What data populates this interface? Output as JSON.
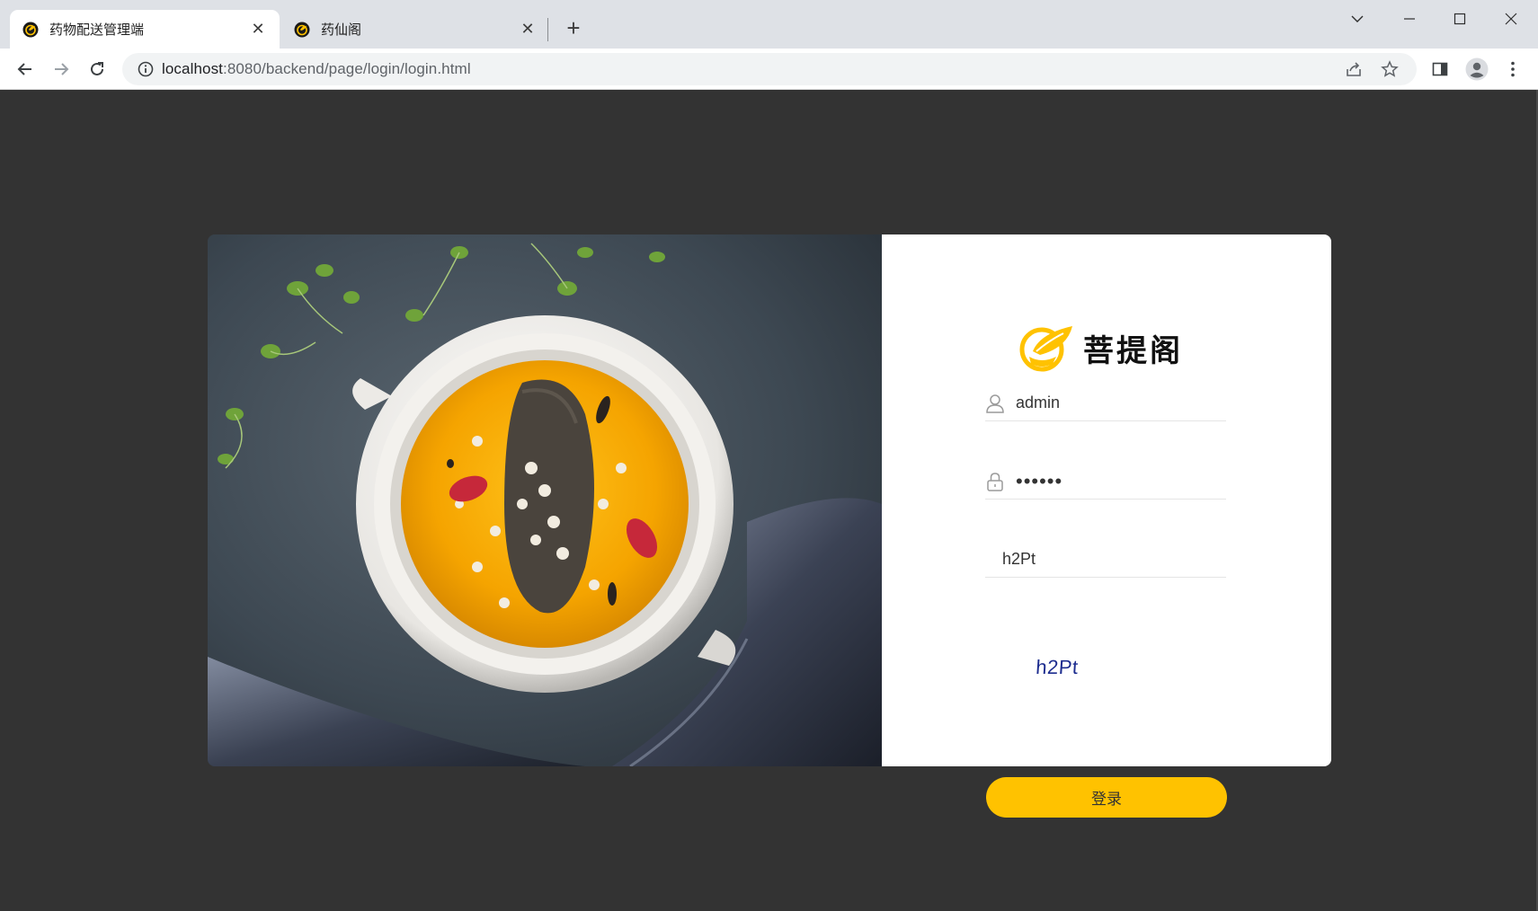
{
  "browser": {
    "tabs": [
      {
        "title": "药物配送管理端",
        "active": true
      },
      {
        "title": "药仙阁",
        "active": false
      }
    ],
    "url": {
      "host": "localhost",
      "path": ":8080/backend/page/login/login.html"
    }
  },
  "brand": {
    "name": "菩提阁"
  },
  "form": {
    "username": "admin",
    "password": "••••••",
    "captcha_input": "h2Pt",
    "captcha_image_text": "h2Pt"
  },
  "login_button": "登录",
  "colors": {
    "accent": "#ffc200",
    "page_bg": "#333333",
    "captcha_text": "#1d2d8f"
  }
}
